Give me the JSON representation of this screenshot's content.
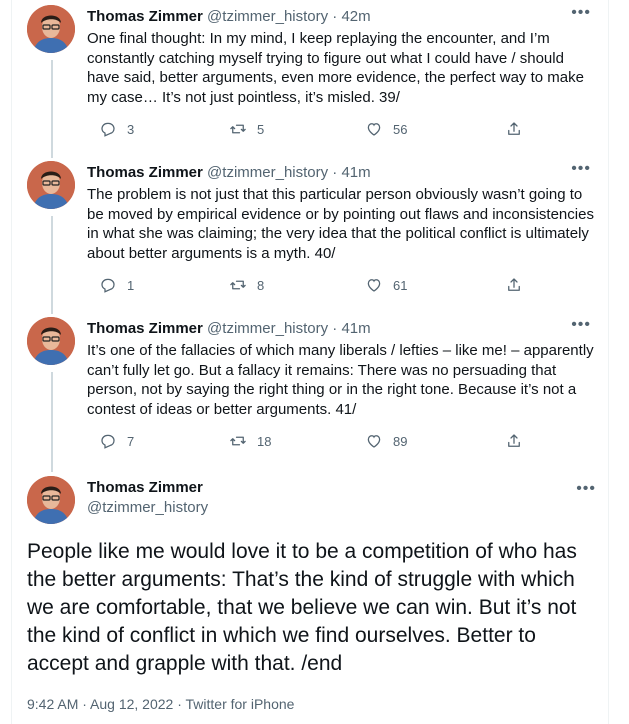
{
  "author": {
    "name": "Thomas Zimmer",
    "handle": "@tzimmer_history"
  },
  "colors": {
    "text": "#0f1419",
    "secondary": "#536471",
    "divider": "#eff3f4",
    "avatar_bg": "#c9674b"
  },
  "icons": [
    "reply-icon",
    "retweet-icon",
    "like-icon",
    "share-icon",
    "more-icon"
  ],
  "thread": [
    {
      "name": "Thomas Zimmer",
      "handle_time": "@tzimmer_history · 42m",
      "text": "One final thought: In my mind, I keep replaying the encounter, and I’m constantly catching myself trying to figure out what I could have / should have said, better arguments, even more evidence, the perfect way to make my case… It’s not just pointless, it’s misled. 39/",
      "replies": "3",
      "retweets": "5",
      "likes": "56"
    },
    {
      "name": "Thomas Zimmer",
      "handle_time": "@tzimmer_history · 41m",
      "text": "The problem is not just that this particular person obviously wasn’t going to be moved by empirical evidence or by pointing out flaws and inconsistencies in what she was claiming; the very idea that the political conflict is ultimately about better arguments is a myth. 40/",
      "replies": "1",
      "retweets": "8",
      "likes": "61"
    },
    {
      "name": "Thomas Zimmer",
      "handle_time": "@tzimmer_history · 41m",
      "text": "It’s one of the fallacies of which many liberals / lefties – like me! – apparently can’t fully let go. But a fallacy it remains: There was no persuading that person, not by saying the right thing or in the right tone. Because it’s not a contest of ideas or better arguments. 41/",
      "replies": "7",
      "retweets": "18",
      "likes": "89"
    }
  ],
  "main_tweet": {
    "name": "Thomas Zimmer",
    "handle": "@tzimmer_history",
    "text": "People like me would love it to be a competition of who has the better arguments: That’s the kind of struggle with which we are comfortable, that we believe we can win. But it’s not the kind of conflict in which we find ourselves. Better to accept and grapple with that. /end",
    "meta": "9:42 AM · Aug 12, 2022 · Twitter for iPhone"
  },
  "more_glyph": "•••"
}
